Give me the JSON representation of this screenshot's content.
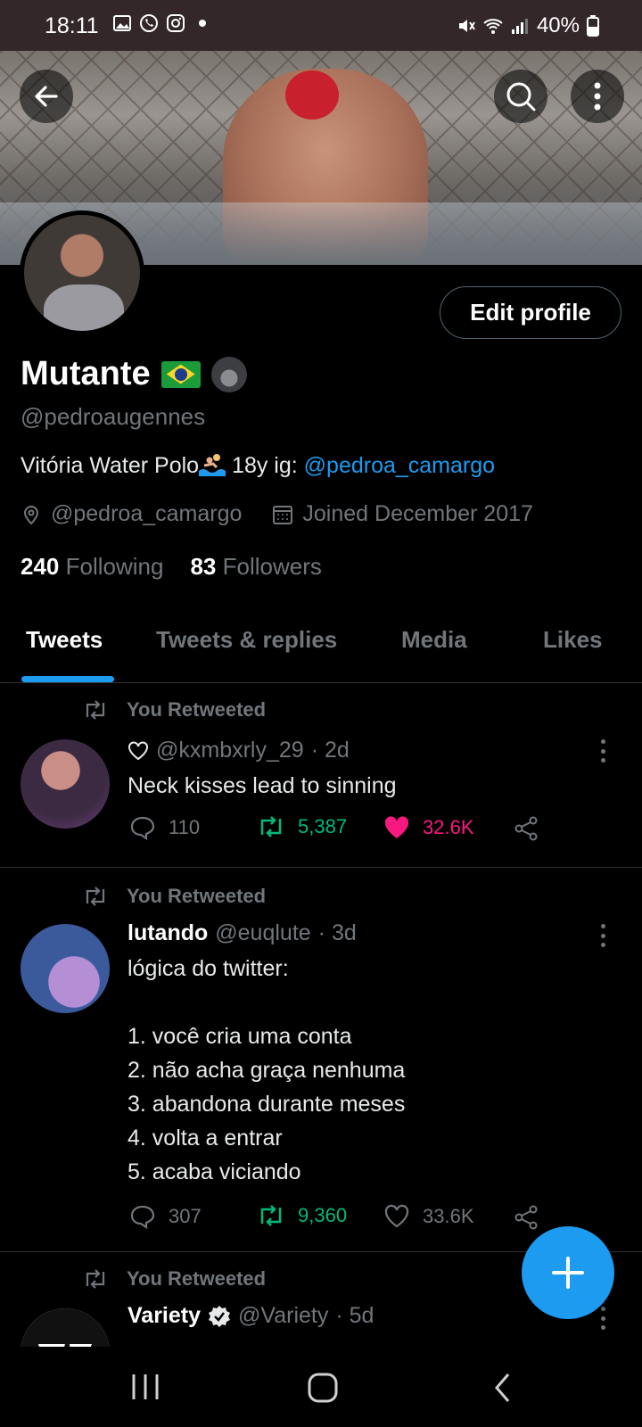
{
  "status_bar": {
    "time": "18:11",
    "battery": "40%",
    "icons": [
      "gallery-icon",
      "whatsapp-icon",
      "instagram-icon",
      "dot-icon",
      "mute-icon",
      "wifi-icon",
      "signal-icon",
      "battery-icon"
    ]
  },
  "profile": {
    "name": "Mutante",
    "handle": "@pedroaugennes",
    "bio_text": "Vitória Water Polo",
    "bio_mid": " 18y ig: ",
    "bio_link": "@pedroa_camargo",
    "location": "@pedroa_camargo",
    "joined": "Joined December 2017",
    "following_count": "240",
    "following_label": "Following",
    "followers_count": "83",
    "followers_label": "Followers",
    "edit_label": "Edit profile"
  },
  "tabs": [
    "Tweets",
    "Tweets & replies",
    "Media",
    "Likes"
  ],
  "tweets": [
    {
      "retweet_label": "You Retweeted",
      "author": "",
      "handle": "@kxmbxrly_29",
      "time": "· 2d",
      "body": "Neck kisses lead to sinning",
      "replies": "110",
      "retweets": "5,387",
      "likes": "32.6K"
    },
    {
      "retweet_label": "You Retweeted",
      "author": "lutando",
      "handle": "@euqlute",
      "time": "· 3d",
      "body": "lógica do twitter:\n\n1. você cria uma conta\n2. não acha graça nenhuma\n3. abandona durante meses\n4. volta a entrar\n5. acaba viciando",
      "replies": "307",
      "retweets": "9,360",
      "likes": "33.6K"
    },
    {
      "retweet_label": "You Retweeted",
      "author": "Variety",
      "handle": "@Variety",
      "time": "· 5d"
    }
  ],
  "colors": {
    "accent": "#1d9bf0",
    "retweet": "#00ba7c",
    "like": "#f91880",
    "muted": "#71767b"
  }
}
